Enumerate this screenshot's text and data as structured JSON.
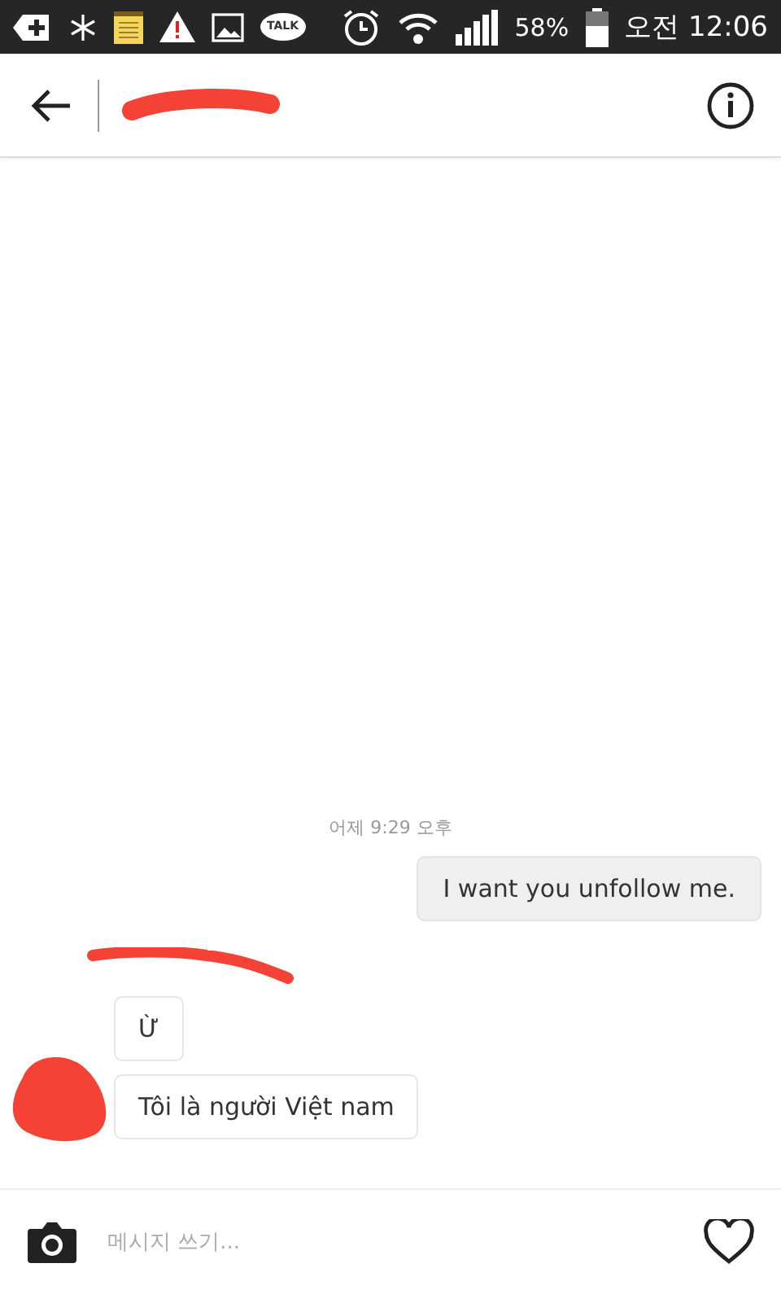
{
  "status_bar": {
    "notification_badge": "TALK",
    "battery": "58%",
    "time": "오전 12:06"
  },
  "messages": [
    {
      "kind": "timestamp",
      "text": "어제 9:29 오후"
    },
    {
      "kind": "outgoing",
      "text": "I want you unfollow me."
    },
    {
      "kind": "incoming",
      "text": "Ừ"
    },
    {
      "kind": "incoming",
      "text": "Tôi là người Việt nam"
    }
  ],
  "composer": {
    "placeholder": "메시지 쓰기..."
  }
}
